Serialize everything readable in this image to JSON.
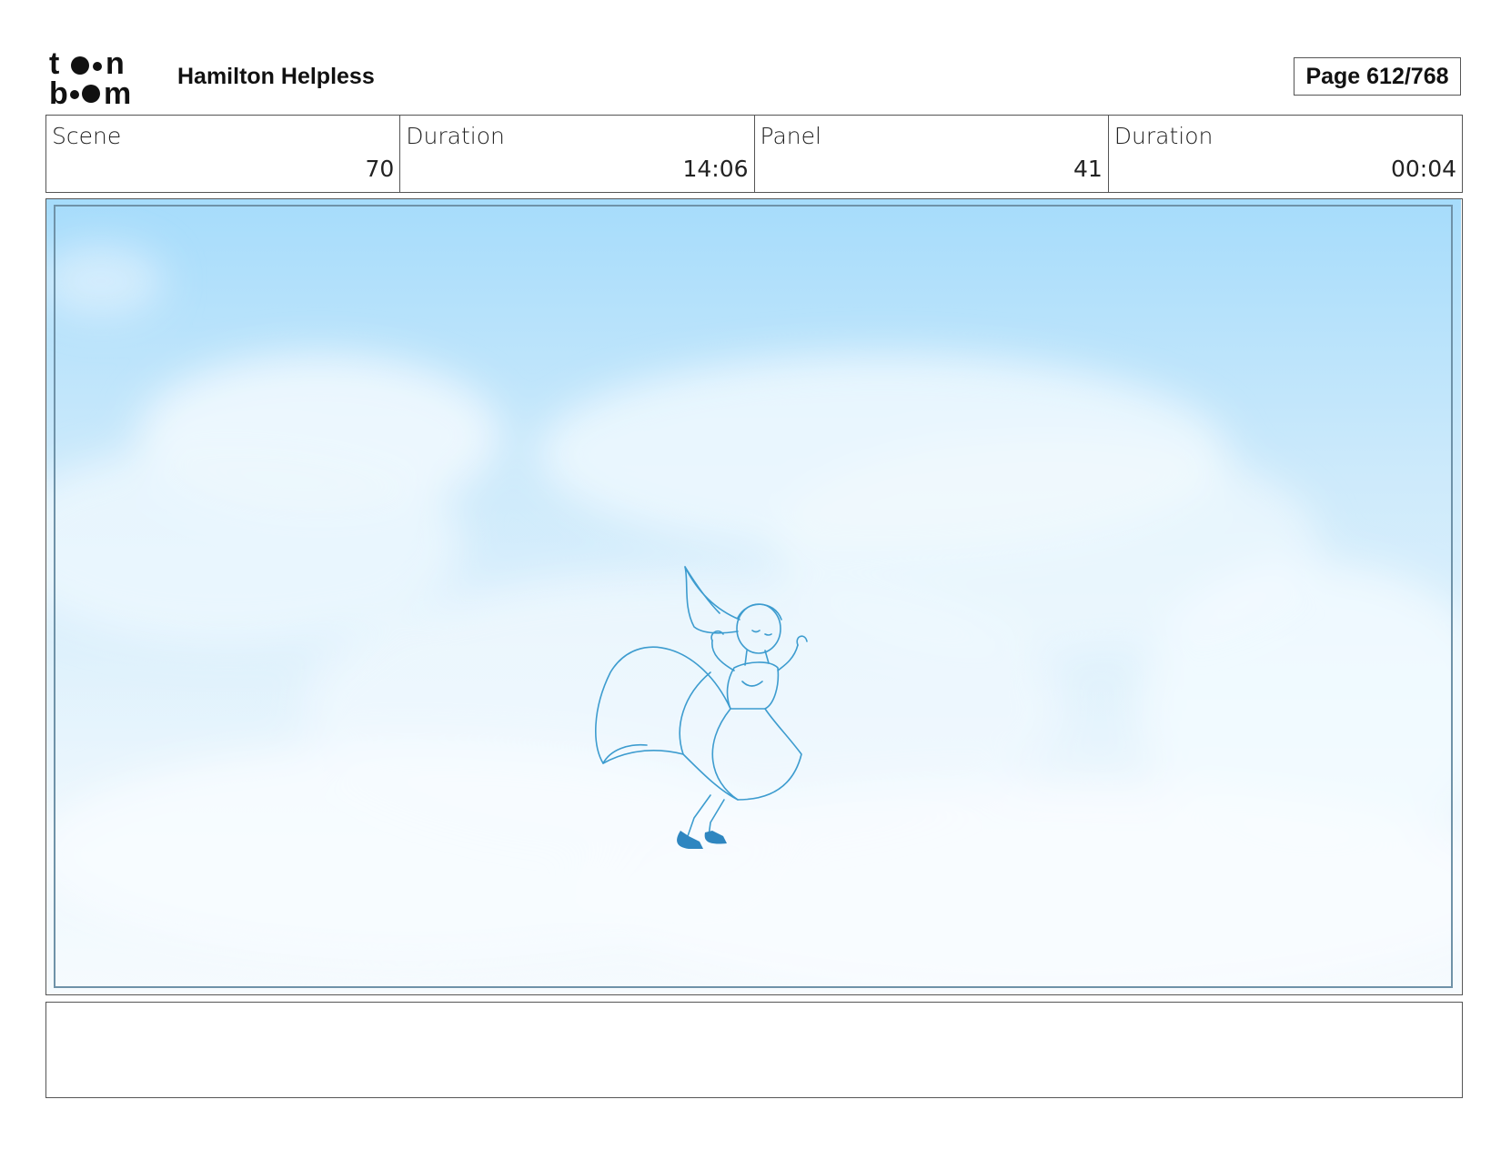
{
  "header": {
    "logo_text": "toon boom",
    "project_title": "Hamilton Helpless",
    "page_label": "Page 612/768"
  },
  "info": {
    "scene_label": "Scene",
    "scene_value": "70",
    "scene_duration_label": "Duration",
    "scene_duration_value": "14:06",
    "panel_label": "Panel",
    "panel_value": "41",
    "panel_duration_label": "Duration",
    "panel_duration_value": "00:04"
  },
  "notes": {
    "text": ""
  },
  "colors": {
    "sky_top": "#a6dcfb",
    "sky_bottom": "#f6fbfe",
    "sketch_line": "#3d9ccf",
    "border": "#555555"
  }
}
